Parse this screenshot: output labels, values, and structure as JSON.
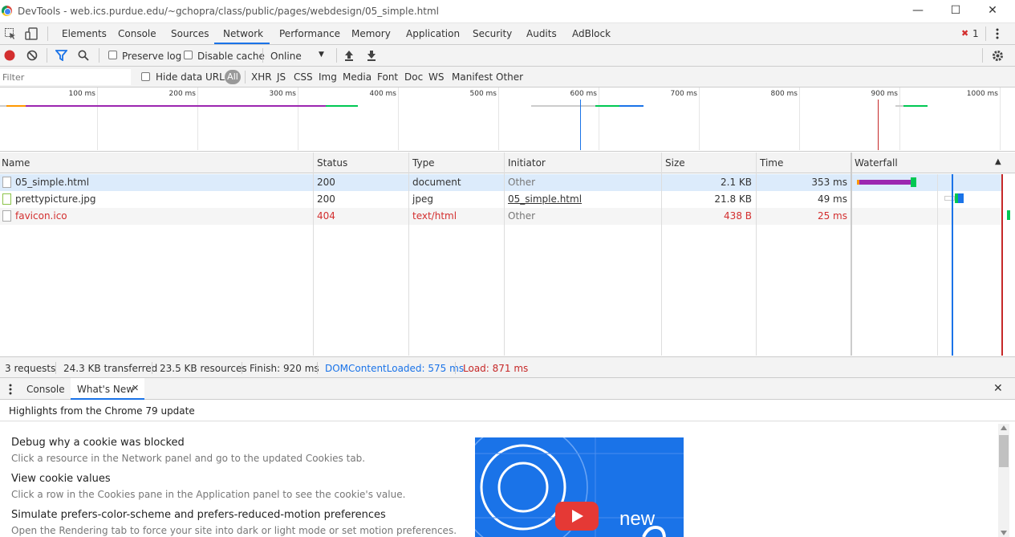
{
  "window": {
    "title": "DevTools - web.ics.purdue.edu/~gchopra/class/public/pages/webdesign/05_simple.html",
    "controls": [
      "—",
      "☐",
      "✕"
    ]
  },
  "tabs": [
    "Elements",
    "Console",
    "Sources",
    "Network",
    "Performance",
    "Memory",
    "Application",
    "Security",
    "Audits",
    "AdBlock"
  ],
  "active_tab": "Network",
  "errors": {
    "count": "1",
    "icon": "✖"
  },
  "toolbar": {
    "preserve_log": "Preserve log",
    "disable_cache": "Disable cache",
    "throttle": "Online",
    "throttle_arrow": "▼"
  },
  "filter": {
    "placeholder": "Filter",
    "hide_data_urls": "Hide data URLs",
    "types": [
      "All",
      "XHR",
      "JS",
      "CSS",
      "Img",
      "Media",
      "Font",
      "Doc",
      "WS",
      "Manifest",
      "Other"
    ]
  },
  "overview": {
    "ticks": [
      "100 ms",
      "200 ms",
      "300 ms",
      "400 ms",
      "500 ms",
      "600 ms",
      "700 ms",
      "800 ms",
      "900 ms",
      "1000 ms"
    ]
  },
  "columns": [
    "Name",
    "Status",
    "Type",
    "Initiator",
    "Size",
    "Time",
    "Waterfall"
  ],
  "sort_indicator": "▲",
  "requests": [
    {
      "name": "05_simple.html",
      "status": "200",
      "type": "document",
      "initiator": "Other",
      "size": "2.1 KB",
      "time": "353 ms",
      "error": false
    },
    {
      "name": "prettypicture.jpg",
      "status": "200",
      "type": "jpeg",
      "initiator": "05_simple.html",
      "size": "21.8 KB",
      "time": "49 ms",
      "error": false
    },
    {
      "name": "favicon.ico",
      "status": "404",
      "type": "text/html",
      "initiator": "Other",
      "size": "438 B",
      "time": "25 ms",
      "error": true
    }
  ],
  "status": {
    "requests": "3 requests",
    "transferred": "24.3 KB transferred",
    "resources": "23.5 KB resources",
    "finish": "Finish: 920 ms",
    "domcontentloaded": "DOMContentLoaded: 575 ms",
    "load": "Load: 871 ms"
  },
  "drawer": {
    "tabs": [
      "Console",
      "What's New"
    ],
    "active": "What's New",
    "close_tab": "✕",
    "close_drawer": "✕",
    "highlights": "Highlights from the Chrome 79 update",
    "items": [
      {
        "title": "Debug why a cookie was blocked",
        "desc": "Click a resource in the Network panel and go to the updated Cookies tab."
      },
      {
        "title": "View cookie values",
        "desc": "Click a row in the Cookies pane in the Application panel to see the cookie's value."
      },
      {
        "title": "Simulate prefers-color-scheme and prefers-reduced-motion preferences",
        "desc": "Open the Rendering tab to force your site into dark or light mode or set motion preferences."
      }
    ],
    "video_text": "new"
  },
  "colors": {
    "accent": "#1a73e8",
    "error": "#d32f2f",
    "dcl": "#1a73e8",
    "load": "#c62828",
    "waiting": "#9c27b0",
    "download": "#00c853",
    "selected_row": "#dcebfb"
  }
}
